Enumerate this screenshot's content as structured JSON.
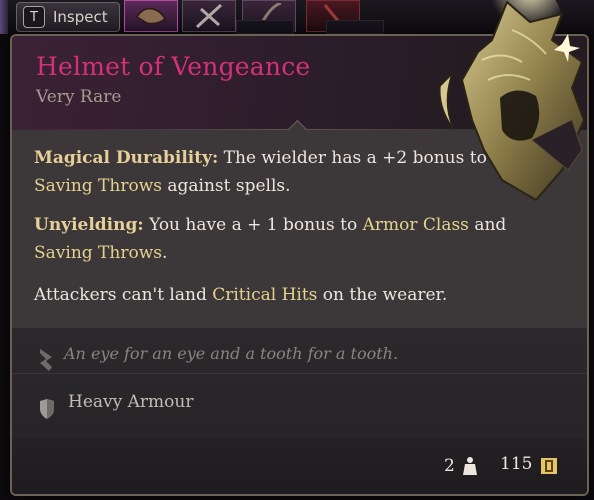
{
  "hotbar": {
    "inspect_key": "T",
    "inspect_label": "Inspect"
  },
  "item": {
    "name": "Helmet of Vengeance",
    "rarity": "Very Rare",
    "name_color": "#d4317a",
    "properties": [
      {
        "title": "Magical Durability:",
        "text_parts": [
          "The wielder has a +2 bonus to ",
          "Saving Throws",
          " against spells."
        ]
      },
      {
        "title": "Unyielding:",
        "text_parts": [
          "You have a + 1 bonus to ",
          "Armor Class",
          " and ",
          "Saving Throws",
          "."
        ]
      },
      {
        "title": "",
        "text_parts": [
          "Attackers can't land ",
          "Critical Hits",
          " on the wearer."
        ]
      }
    ],
    "lore": "An eye for an eye and a tooth for a tooth.",
    "proficiency": "Heavy Armour",
    "weight": "2",
    "value": "115"
  },
  "icons": {
    "lore": "quill-icon",
    "proficiency": "shield-icon",
    "weight": "weight-icon",
    "value": "gold-coin-icon"
  },
  "colors": {
    "keyword": "#e6d28e",
    "label": "#e8cf9a",
    "body_text": "#ece6df",
    "lore_text": "#8a8380"
  }
}
